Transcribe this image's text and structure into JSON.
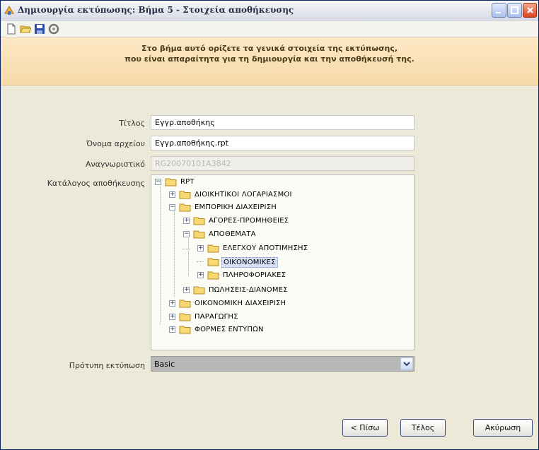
{
  "window": {
    "title": "Δημιουργία εκτύπωσης: Βήμα 5 - Στοιχεία αποθήκευσης"
  },
  "toolbar": {
    "icons": [
      "new-document-icon",
      "open-folder-icon",
      "save-disk-icon",
      "refresh-icon"
    ]
  },
  "banner": {
    "line1": "Στο βήμα αυτό ορίζετε τα γενικά στοιχεία της εκτύπωσης,",
    "line2": "που είναι απαραίτητα για τη δημιουργία και την αποθήκευσή της."
  },
  "form": {
    "title_label": "Τίτλος",
    "title_value": "Εγγρ.αποθήκης",
    "filename_label": "Όνομα αρχείου",
    "filename_value": "Εγγρ.αποθήκης.rpt",
    "id_label": "Αναγνωριστικό",
    "id_value": "RG20070101A3842",
    "folder_label": "Κατάλογος αποθήκευσης",
    "template_label": "Πρότυπη εκτύπωση",
    "template_value": "Basic"
  },
  "tree": {
    "nodes": [
      {
        "label": "RPT",
        "expander": "−"
      },
      {
        "label": "ΔΙΟΙΚΗΤΙΚΟΙ ΛΟΓΑΡΙΑΣΜΟΙ",
        "expander": "+"
      },
      {
        "label": "ΕΜΠΟΡΙΚΗ ΔΙΑΧΕΙΡΙΣΗ",
        "expander": "−"
      },
      {
        "label": "ΑΓΟΡΕΣ-ΠΡΟΜΗΘΕΙΕΣ",
        "expander": "+"
      },
      {
        "label": "ΑΠΟΘΕΜΑΤΑ",
        "expander": "−"
      },
      {
        "label": "ΕΛΕΓΧΟΥ ΑΠΟΤΙΜΗΣΗΣ",
        "expander": "+"
      },
      {
        "label": "ΟΙΚΟΝΟΜΙΚΕΣ",
        "expander": "",
        "selected": true
      },
      {
        "label": "ΠΛΗΡΟΦΟΡΙΑΚΕΣ",
        "expander": "+"
      },
      {
        "label": "ΠΩΛΗΣΕΙΣ-ΔΙΑΝΟΜΕΣ",
        "expander": "+"
      },
      {
        "label": "ΟΙΚΟΝΟΜΙΚΗ ΔΙΑΧΕΙΡΙΣΗ",
        "expander": "+"
      },
      {
        "label": "ΠΑΡΑΓΩΓΗΣ",
        "expander": "+"
      },
      {
        "label": "ΦΟΡΜΕΣ ΕΝΤΥΠΩΝ",
        "expander": "+"
      }
    ]
  },
  "buttons": {
    "back": "< Πίσω",
    "finish": "Τέλος",
    "cancel": "Ακύρωση"
  },
  "colors": {
    "banner": "#f6d9a8",
    "window_bg": "#ece9d8",
    "selection": "#d7dff4"
  }
}
